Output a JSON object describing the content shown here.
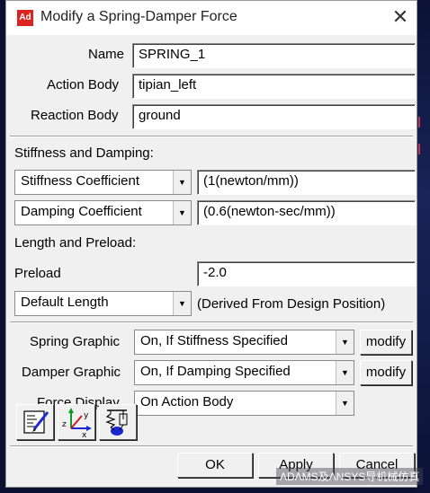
{
  "window": {
    "icon_text": "Ad",
    "title": "Modify a Spring-Damper Force",
    "close_glyph": "✕"
  },
  "fields": {
    "name_label": "Name",
    "name_value": "SPRING_1",
    "action_body_label": "Action Body",
    "action_body_value": "tipian_left",
    "reaction_body_label": "Reaction Body",
    "reaction_body_value": "ground"
  },
  "stiffness": {
    "section_label": "Stiffness and Damping:",
    "stiffness_option": "Stiffness Coefficient",
    "stiffness_value": "(1(newton/mm))",
    "damping_option": "Damping Coefficient",
    "damping_value": "(0.6(newton-sec/mm))"
  },
  "length": {
    "section_label": "Length and Preload:",
    "preload_label": "Preload",
    "preload_value": "-2.0",
    "length_option": "Default Length",
    "length_note": "(Derived From Design Position)"
  },
  "graphics": {
    "spring_label": "Spring Graphic",
    "spring_value": "On, If Stiffness Specified",
    "damper_label": "Damper Graphic",
    "damper_value": "On, If Damping Specified",
    "force_label": "Force Display",
    "force_value": "On Action Body",
    "modify_label": "modify"
  },
  "buttons": {
    "ok": "OK",
    "apply": "Apply",
    "cancel": "Cancel"
  },
  "watermark": "ADAMS及ANSYS导机械仿真",
  "icons": [
    "edit-notes-icon",
    "xyz-axes-icon",
    "spring-damper-icon",
    "dropdown-arrow-icon",
    "close-icon"
  ],
  "colors": {
    "dialog_bg": "#f0f0f0",
    "desktop_bg": "#0a1030",
    "app_icon": "#dd2222"
  }
}
